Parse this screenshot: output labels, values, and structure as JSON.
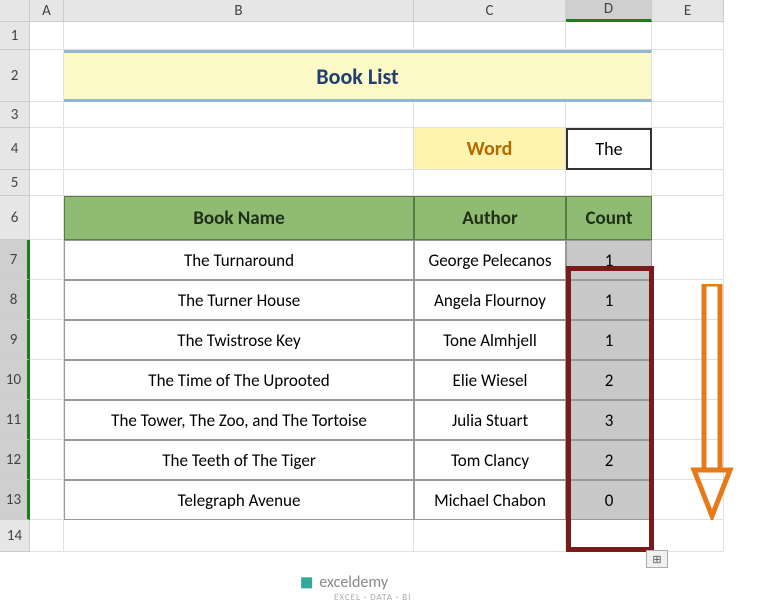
{
  "columns": [
    "",
    "A",
    "B",
    "C",
    "D",
    "E"
  ],
  "rows": [
    "1",
    "2",
    "3",
    "4",
    "5",
    "6",
    "7",
    "8",
    "9",
    "10",
    "11",
    "12",
    "13",
    "14"
  ],
  "title": "Book List",
  "word_label": "Word",
  "word_value": "The",
  "headers": {
    "book": "Book Name",
    "author": "Author",
    "count": "Count"
  },
  "data": [
    {
      "book": "The Turnaround",
      "author": "George Pelecanos",
      "count": 1
    },
    {
      "book": "The Turner House",
      "author": "Angela Flournoy",
      "count": 1
    },
    {
      "book": "The Twistrose Key",
      "author": "Tone Almhjell",
      "count": 1
    },
    {
      "book": "The Time of The Uprooted",
      "author": "Elie Wiesel",
      "count": 2
    },
    {
      "book": "The Tower, The Zoo, and The Tortoise",
      "author": "Julia Stuart",
      "count": 3
    },
    {
      "book": "The Teeth of The Tiger",
      "author": "Tom Clancy",
      "count": 2
    },
    {
      "book": "Telegraph Avenue",
      "author": "Michael Chabon",
      "count": 0
    }
  ],
  "chart_data": {
    "type": "table",
    "title": "Book List",
    "columns": [
      "Book Name",
      "Author",
      "Count"
    ],
    "rows": [
      [
        "The Turnaround",
        "George Pelecanos",
        1
      ],
      [
        "The Turner House",
        "Angela Flournoy",
        1
      ],
      [
        "The Twistrose Key",
        "Tone Almhjell",
        1
      ],
      [
        "The Time of The Uprooted",
        "Elie Wiesel",
        2
      ],
      [
        "The Tower, The Zoo, and The Tortoise",
        "Julia Stuart",
        3
      ],
      [
        "The Teeth of The Tiger",
        "Tom Clancy",
        2
      ],
      [
        "Telegraph Avenue",
        "Michael Chabon",
        0
      ]
    ],
    "lookup": {
      "word": "The"
    }
  },
  "logo": {
    "name": "exceldemy",
    "sub": "EXCEL · DATA · BI"
  },
  "fill_icon": "⊞"
}
